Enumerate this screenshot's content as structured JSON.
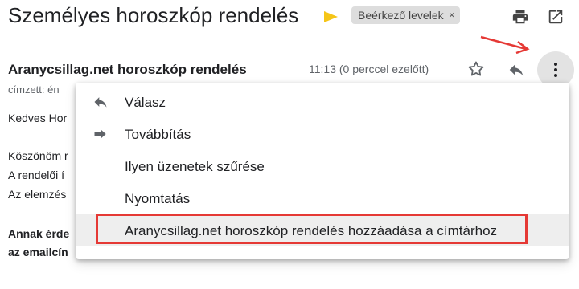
{
  "header": {
    "subject": "Személyes horoszkóp rendelés",
    "label_chip": "Beérkező levelek",
    "label_close": "×",
    "importance_icon": "importance-marker-icon",
    "print_icon": "print-icon",
    "open_new_window_icon": "open-in-new-icon"
  },
  "message": {
    "sender": "Aranycsillag.net horoszkóp rendelés",
    "time": "11:13 (0 perccel ezelőtt)",
    "to_line": "címzett: én",
    "body_lines": [
      "Kedves Hor",
      "Köszönöm r",
      "A rendelői í",
      "Az elemzés",
      "Annak érde",
      "az emailcín"
    ]
  },
  "menu": {
    "items": [
      {
        "label": "Válasz",
        "icon": "reply-icon"
      },
      {
        "label": "Továbbítás",
        "icon": "forward-icon"
      },
      {
        "label": "Ilyen üzenetek szűrése",
        "icon": ""
      },
      {
        "label": "Nyomtatás",
        "icon": ""
      },
      {
        "label": "Aranycsillag.net horoszkóp rendelés hozzáadása a címtárhoz",
        "icon": ""
      }
    ]
  },
  "colors": {
    "accent_red": "#e53935",
    "importance_yellow": "#f5c518",
    "chip_bg": "#dddddd"
  }
}
